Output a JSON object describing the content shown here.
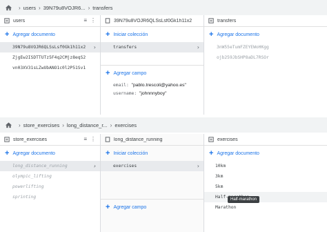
{
  "top": {
    "breadcrumb": [
      "users",
      "39N79u8VOJR6...",
      "transfers"
    ],
    "col1": {
      "title": "users",
      "add_label": "Agregar documento",
      "items": [
        "39N79u8VOJR6QLSsLsf0Gk1h11x2",
        "ZjgEw2ISDTTUTz5F4q2CMjz8eqS2",
        "vn03XV31sLZwUbANO1c0l2P51Sv1"
      ]
    },
    "col2": {
      "title": "39N79u8VOJR6QLSsLsf0Gk1h11x2",
      "start_collection_label": "Iniciar colección",
      "items": [
        "transfers"
      ],
      "add_field_label": "Agregar campo",
      "fields": [
        {
          "key": "email:",
          "value": "\"pablo.trescoli@yahoo.es\""
        },
        {
          "key": "username:",
          "value": "\"johnnnyboy\""
        }
      ]
    },
    "col3": {
      "title": "transfers",
      "add_label": "Agregar documento",
      "items": [
        "3nW55eTumFZEYEWoHKgg",
        "ojb259JbSHP8aDL7RSOr"
      ]
    }
  },
  "bottom": {
    "breadcrumb": [
      "store_exercises",
      "long_distance_r...",
      "exercises"
    ],
    "col1": {
      "title": "store_exercises",
      "add_label": "Agregar documento",
      "items": [
        "long_distance_running",
        "olympic_lifting",
        "powerlifting",
        "sprinting"
      ]
    },
    "col2": {
      "title": "long_distance_running",
      "start_collection_label": "Iniciar colección",
      "items": [
        "exercises"
      ],
      "add_field_label": "Agregar campo"
    },
    "col3": {
      "title": "exercises",
      "add_label": "Agregar documento",
      "items": [
        "10km",
        "3km",
        "5km",
        "Half-marathon",
        "Marathon"
      ],
      "tooltip": "Half-marathon"
    }
  },
  "icons": {
    "home": "home-icon",
    "collection": "collection-icon",
    "document": "document-icon",
    "filter": "filter-icon",
    "more": "more-vert-icon",
    "chevron": "chevron-right-icon",
    "plus": "plus-icon"
  },
  "colors": {
    "accent": "#1a73e8",
    "selected": "#e8eaed",
    "breadcrumb_bg": "#f1f3f4"
  }
}
